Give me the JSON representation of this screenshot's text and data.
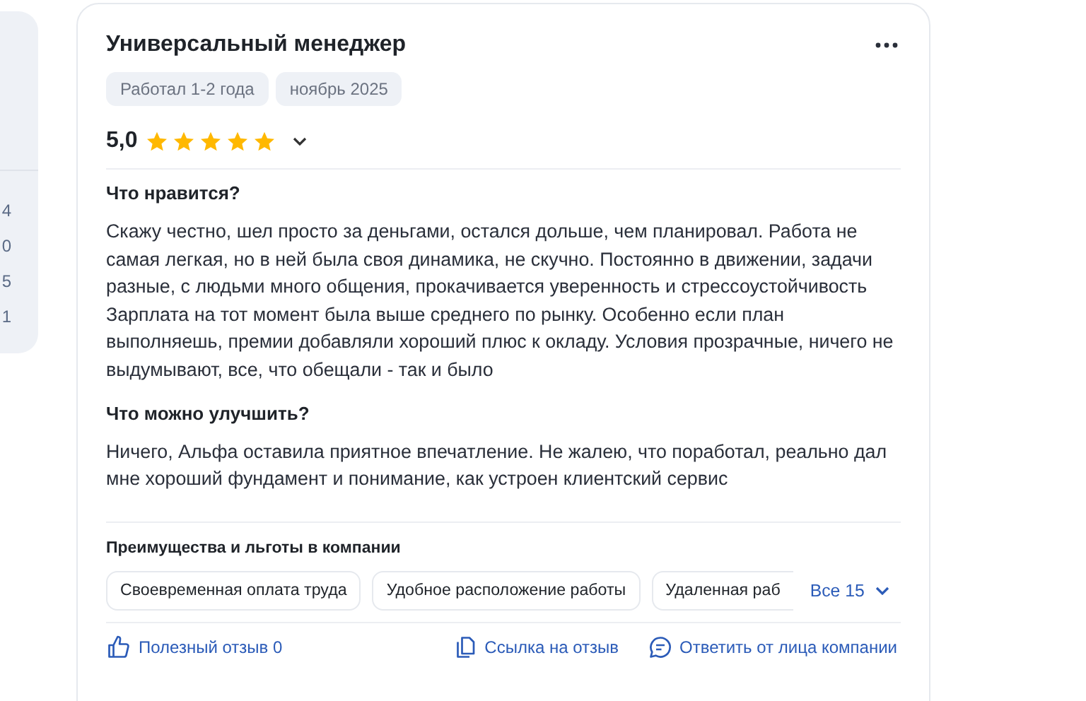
{
  "side_card": {
    "values": [
      "4",
      "0",
      "5",
      "1"
    ]
  },
  "review": {
    "title": "Универсальный менеджер",
    "tags": [
      "Работал 1-2 года",
      "ноябрь 2025"
    ],
    "rating": "5,0",
    "stars": 5,
    "sections": [
      {
        "heading": "Что нравится?",
        "text": "Скажу честно, шел просто за деньгами, остался дольше, чем планировал. Работа не самая легкая, но в ней была своя динамика, не скучно. Постоянно в движении, задачи разные, с людьми много общения, прокачивается уверенность и стрессоустойчивость Зарплата на тот момент была выше среднего по рынку. Особенно если план выполняешь, премии добавляли хороший плюс к окладу. Условия прозрачные, ничего не выдумывают, все, что обещали - так и было"
      },
      {
        "heading": "Что можно улучшить?",
        "text": "Ничего, Альфа оставила приятное впечатление. Не жалею, что поработал, реально дал мне хороший фундамент и понимание, как устроен клиентский сервис"
      }
    ],
    "benefits": {
      "heading": "Преимущества и льготы в компании",
      "items": [
        "Своевременная оплата труда",
        "Удобное расположение работы",
        "Удаленная раб"
      ],
      "more": "Все 15"
    },
    "actions": [
      {
        "kind": "like",
        "label": "Полезный отзыв 0"
      },
      {
        "kind": "link",
        "label": "Ссылка на отзыв"
      },
      {
        "kind": "reply",
        "label": "Ответить от лица компании"
      }
    ]
  }
}
